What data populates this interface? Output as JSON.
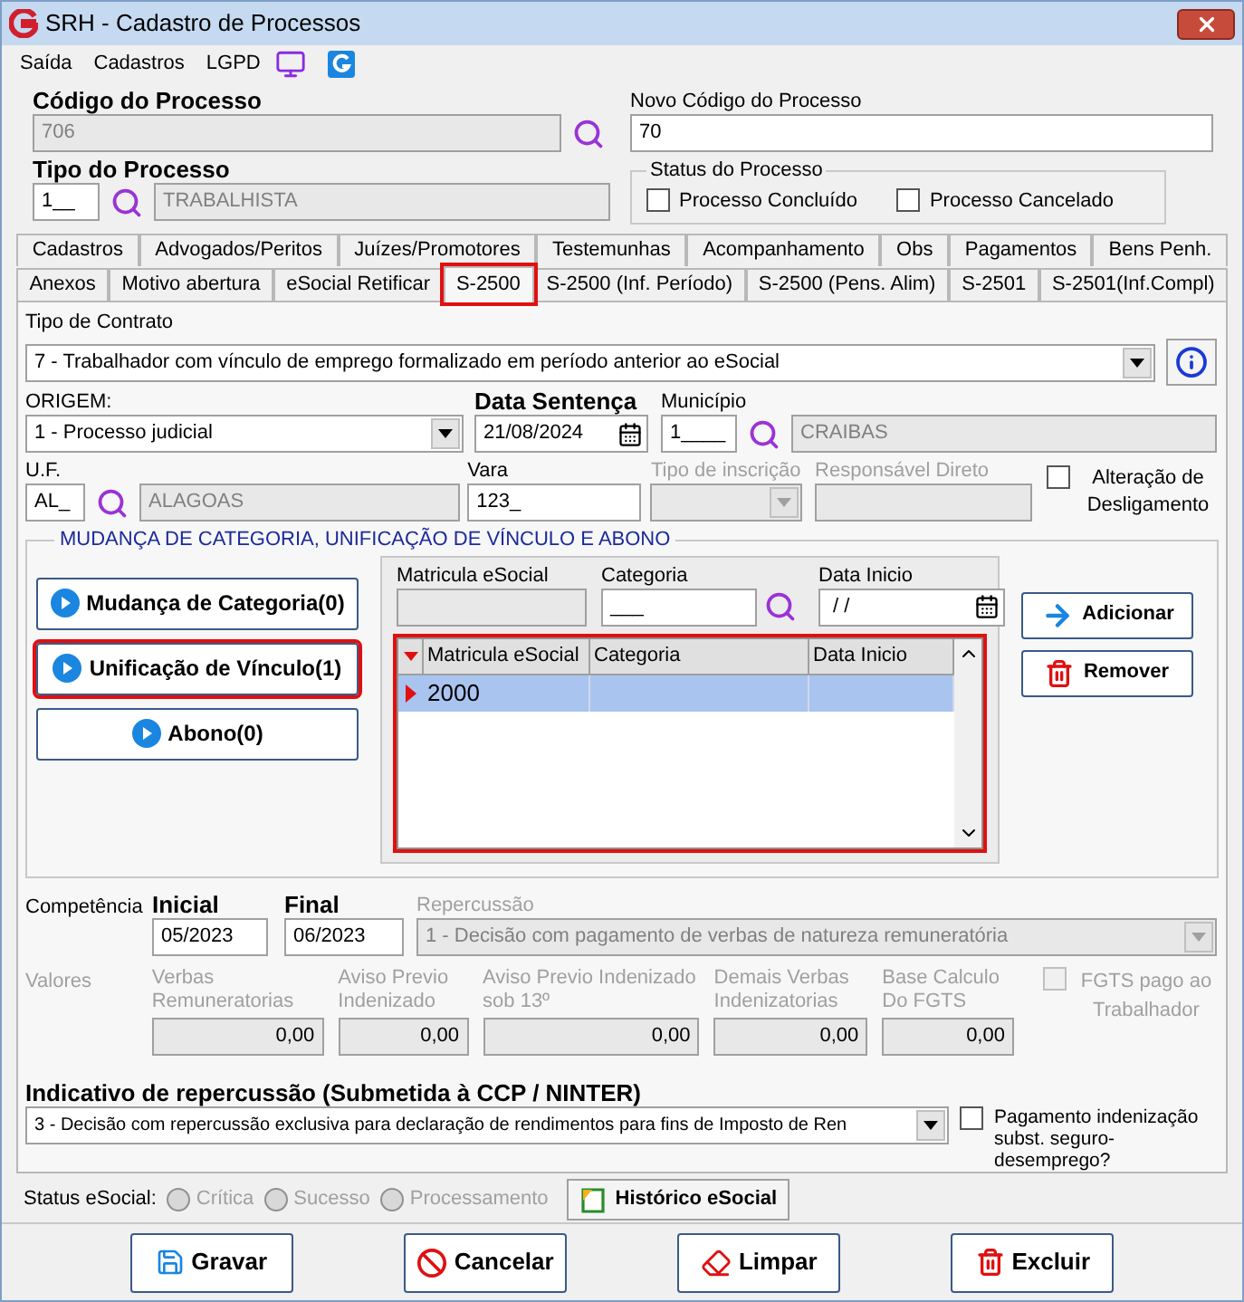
{
  "window": {
    "title": "SRH - Cadastro de Processos"
  },
  "menu": [
    "Saída",
    "Cadastros",
    "LGPD"
  ],
  "codigo": {
    "label": "Código do Processo",
    "value": "706"
  },
  "novo_codigo": {
    "label": "Novo Código do Processo",
    "value": "70"
  },
  "tipo": {
    "label": "Tipo do Processo",
    "code": "1__",
    "name": "TRABALHISTA"
  },
  "status_processo": {
    "title": "Status do Processo",
    "options": [
      {
        "label": "Processo Concluído",
        "checked": false
      },
      {
        "label": "Processo Cancelado",
        "checked": false
      }
    ]
  },
  "tabs_back": [
    {
      "label": "Cadastros",
      "selected": false
    },
    {
      "label": "Advogados/Peritos",
      "selected": false
    },
    {
      "label": "Juízes/Promotores",
      "selected": false
    },
    {
      "label": "Testemunhas",
      "selected": false
    },
    {
      "label": "Acompanhamento",
      "selected": false
    },
    {
      "label": "Obs",
      "selected": false
    },
    {
      "label": "Pagamentos",
      "selected": false
    },
    {
      "label": "Bens Penh.",
      "selected": false
    }
  ],
  "tabs_front": [
    {
      "label": "Anexos",
      "selected": false
    },
    {
      "label": "Motivo abertura",
      "selected": false
    },
    {
      "label": "eSocial Retificar",
      "selected": false
    },
    {
      "label": "S-2500",
      "selected": true,
      "highlighted": true
    },
    {
      "label": "S-2500 (Inf. Período)",
      "selected": false
    },
    {
      "label": "S-2500 (Pens. Alim)",
      "selected": false
    },
    {
      "label": "S-2501",
      "selected": false
    },
    {
      "label": "S-2501(Inf.Compl)",
      "selected": false
    }
  ],
  "tipo_contrato": {
    "label": "Tipo de Contrato",
    "value": "7 - Trabalhador com vínculo de emprego formalizado em período anterior ao eSocial"
  },
  "origem": {
    "label": "ORIGEM:",
    "value": "1 - Processo judicial"
  },
  "data_sentenca": {
    "label": "Data Sentença",
    "value": "21/08/2024"
  },
  "municipio": {
    "label": "Município",
    "code": "1____",
    "name": "CRAIBAS"
  },
  "uf": {
    "label": "U.F.",
    "code": "AL_",
    "name": "ALAGOAS"
  },
  "vara": {
    "label": "Vara",
    "value": "123_"
  },
  "tipo_inscricao": {
    "label": "Tipo de inscrição",
    "disabled": true
  },
  "responsavel": {
    "label": "Responsável Direto",
    "disabled": true
  },
  "alteracao": {
    "label": "Alteração de Desligamento",
    "checked": false
  },
  "mudanca": {
    "title": "MUDANÇA DE CATEGORIA, UNIFICAÇÃO DE VÍNCULO E ABONO",
    "buttons": [
      {
        "label": "Mudança de Categoria(0)",
        "highlighted": false
      },
      {
        "label": "Unificação de Vínculo(1)",
        "highlighted": true
      },
      {
        "label": "Abono(0)",
        "highlighted": false
      }
    ],
    "matricula_label": "Matricula eSocial",
    "categoria_label": "Categoria",
    "categoria_value": "___",
    "data_label": "Data Inicio",
    "data_value": " / /",
    "grid": {
      "highlighted": true,
      "columns": [
        "Matricula eSocial",
        "Categoria",
        "Data Inicio"
      ],
      "rows": [
        {
          "cells": [
            "2000",
            "",
            ""
          ],
          "selected": true
        }
      ]
    },
    "actions": [
      "Adicionar",
      "Remover"
    ]
  },
  "competencia": {
    "label": "Competência",
    "inicial_label": "Inicial",
    "inicial": "05/2023",
    "final_label": "Final",
    "final": "06/2023",
    "repercussao_label": "Repercussão",
    "repercussao": "1 - Decisão com pagamento de verbas de natureza remuneratória",
    "disabled": true
  },
  "valores": {
    "label": "Valores",
    "disabled": true,
    "fields": [
      {
        "label": "Verbas Remuneratorias",
        "value": "0,00"
      },
      {
        "label": "Aviso Previo Indenizado",
        "value": "0,00"
      },
      {
        "label": "Aviso Previo Indenizado sob 13º",
        "value": "0,00"
      },
      {
        "label": "Demais Verbas Indenizatorias",
        "value": "0,00"
      },
      {
        "label": "Base Calculo Do FGTS",
        "value": "0,00"
      }
    ],
    "fgts": {
      "label": "FGTS pago ao Trabalhador",
      "checked": false
    }
  },
  "indicativo": {
    "label": "Indicativo de repercussão (Submetida à CCP / NINTER)",
    "value": "3 - Decisão com repercussão exclusiva para declaração de rendimentos para fins de Imposto de Ren",
    "pagamento": {
      "label": "Pagamento indenização subst. seguro-desemprego?",
      "checked": false
    }
  },
  "status_esocial": {
    "label": "Status eSocial:",
    "options": [
      {
        "label": "Crítica",
        "selected": false
      },
      {
        "label": "Sucesso",
        "selected": false
      },
      {
        "label": "Processamento",
        "selected": false
      }
    ],
    "historico": "Histórico eSocial"
  },
  "buttons": [
    {
      "kind": "save",
      "label": "Gravar"
    },
    {
      "kind": "cancel",
      "label": "Cancelar"
    },
    {
      "kind": "clear",
      "label": "Limpar"
    },
    {
      "kind": "delete",
      "label": "Excluir"
    }
  ]
}
